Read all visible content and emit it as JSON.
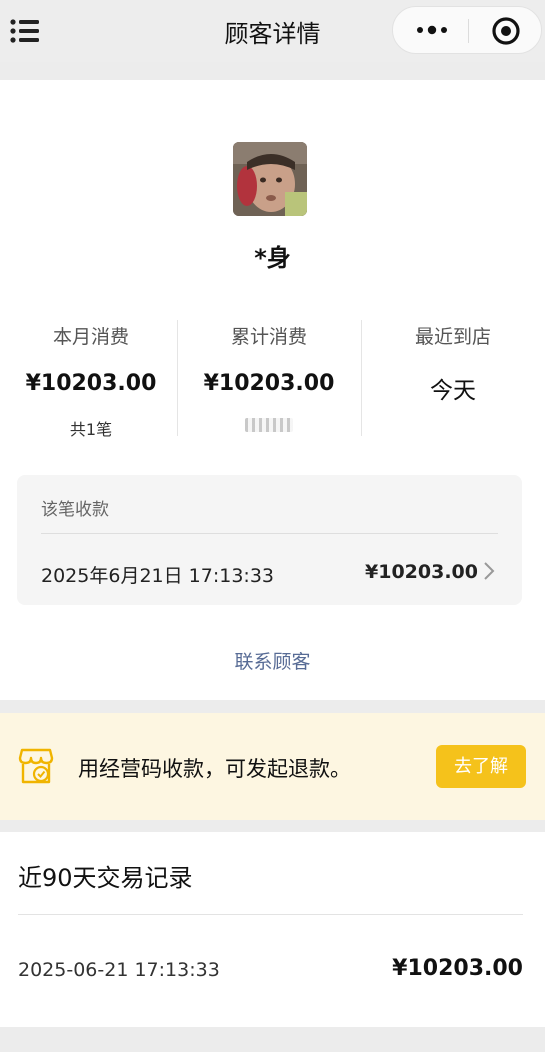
{
  "header": {
    "title": "顾客详情",
    "left_icon": "list-menu-icon",
    "capsule_icons": [
      "more-icon",
      "target-icon"
    ]
  },
  "customer": {
    "name": "*身",
    "avatar": "avatar-photo"
  },
  "stats": [
    {
      "label": "本月消费",
      "value": "¥10203.00",
      "sub": "共1笔"
    },
    {
      "label": "累计消费",
      "value": "¥10203.00",
      "sub": ""
    },
    {
      "label": "最近到店",
      "value": "今天",
      "sub": ""
    }
  ],
  "payment": {
    "title": "该笔收款",
    "time": "2025年6月21日 17:13:33",
    "amount": "¥10203.00"
  },
  "contact_label": "联系顾客",
  "banner": {
    "text": "用经营码收款，可发起退款。",
    "button": "去了解",
    "icon": "shop-code-icon",
    "accent": "#f5c21b",
    "background": "#fdf6e1"
  },
  "records": {
    "title": "近90天交易记录",
    "items": [
      {
        "time": "2025-06-21 17:13:33",
        "amount": "¥10203.00"
      }
    ]
  },
  "colors": {
    "link": "#576b95",
    "page_bg": "#ececec"
  }
}
